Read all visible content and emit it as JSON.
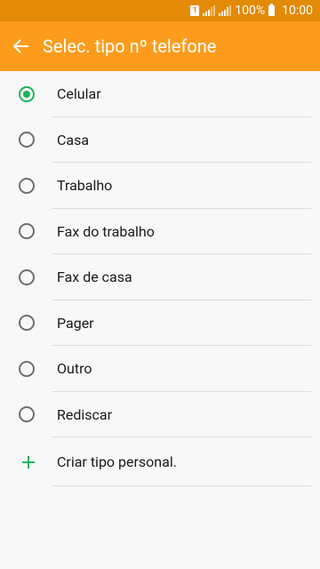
{
  "status_bar": {
    "sim": "1",
    "battery": "100%",
    "time": "10:00"
  },
  "app_bar": {
    "title": "Selec. tipo nº telefone",
    "back_icon": "arrow-left-icon"
  },
  "options": [
    {
      "label": "Celular",
      "selected": true
    },
    {
      "label": "Casa",
      "selected": false
    },
    {
      "label": "Trabalho",
      "selected": false
    },
    {
      "label": "Fax do trabalho",
      "selected": false
    },
    {
      "label": "Fax de casa",
      "selected": false
    },
    {
      "label": "Pager",
      "selected": false
    },
    {
      "label": "Outro",
      "selected": false
    },
    {
      "label": "Rediscar",
      "selected": false
    }
  ],
  "create_custom": {
    "label": "Criar tipo personal.",
    "icon": "plus-icon"
  },
  "colors": {
    "status_bar": "#e38a06",
    "app_bar": "#fd9c1c",
    "accent": "#1ab35b"
  }
}
